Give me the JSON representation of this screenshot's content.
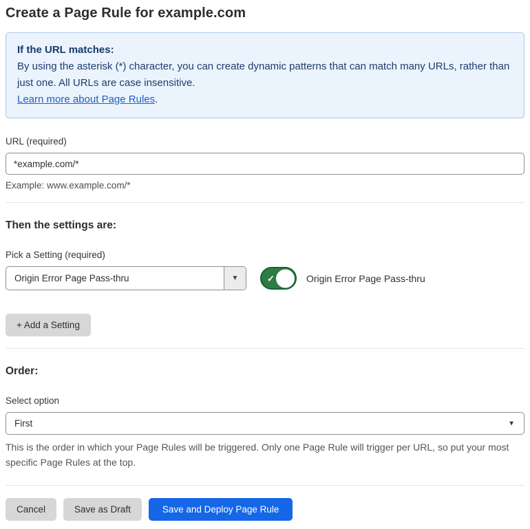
{
  "page": {
    "title": "Create a Page Rule for example.com"
  },
  "info_box": {
    "heading": "If the URL matches:",
    "body": "By using the asterisk (*) character, you can create dynamic patterns that can match many URLs, rather than just one. All URLs are case insensitive.",
    "link_label": "Learn more about Page Rules",
    "link_suffix": "."
  },
  "url_section": {
    "label": "URL (required)",
    "value": "*example.com/*",
    "example": "Example: www.example.com/*"
  },
  "settings_section": {
    "heading": "Then the settings are:",
    "pick_label": "Pick a Setting (required)",
    "selected_setting": "Origin Error Page Pass-thru",
    "dropdown_arrow": "▼",
    "toggle_state": "on",
    "toggle_check": "✓",
    "toggle_label": "Origin Error Page Pass-thru",
    "add_button_label": "+ Add a Setting"
  },
  "order_section": {
    "heading": "Order:",
    "select_label": "Select option",
    "selected_option": "First",
    "select_arrow": "▼",
    "help_text": "This is the order in which your Page Rules will be triggered. Only one Page Rule will trigger per URL, so put your most specific Page Rules at the top."
  },
  "footer": {
    "cancel_label": "Cancel",
    "save_draft_label": "Save as Draft",
    "save_deploy_label": "Save and Deploy Page Rule"
  },
  "colors": {
    "accent_blue": "#1567e8",
    "info_bg": "#ebf3fc",
    "info_border": "#a7c7ee",
    "info_text": "#1f3c6d",
    "link_blue": "#2160c4",
    "toggle_green": "#2d7c43",
    "button_gray": "#d7d7d7"
  }
}
